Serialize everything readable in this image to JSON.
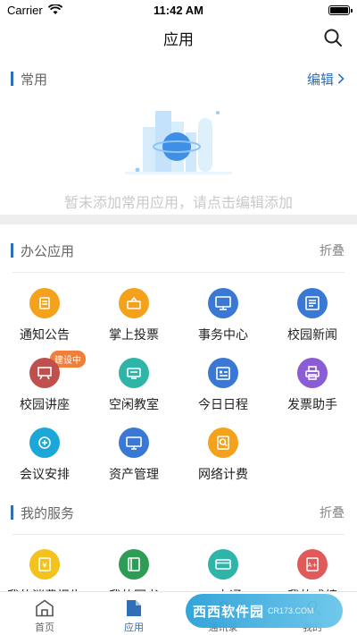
{
  "status": {
    "carrier": "Carrier",
    "time": "11:42 AM"
  },
  "nav": {
    "title": "应用"
  },
  "common": {
    "title": "常用",
    "edit": "编辑",
    "empty": "暂未添加常用应用，请点击编辑添加"
  },
  "office": {
    "title": "办公应用",
    "fold": "折叠",
    "items": [
      {
        "label": "通知公告",
        "icon": "notice-icon",
        "color": "#f4a21c"
      },
      {
        "label": "掌上投票",
        "icon": "vote-icon",
        "color": "#f4a21c"
      },
      {
        "label": "事务中心",
        "icon": "monitor-icon",
        "color": "#3a78d6"
      },
      {
        "label": "校园新闻",
        "icon": "news-icon",
        "color": "#3a78d6"
      },
      {
        "label": "校园讲座",
        "icon": "lecture-icon",
        "color": "#c0504d",
        "badge": "建设中"
      },
      {
        "label": "空闲教室",
        "icon": "classroom-icon",
        "color": "#2eb5a8"
      },
      {
        "label": "今日日程",
        "icon": "schedule-icon",
        "color": "#3a78d6"
      },
      {
        "label": "发票助手",
        "icon": "printer-icon",
        "color": "#8a5cd6"
      },
      {
        "label": "会议安排",
        "icon": "meeting-icon",
        "color": "#1ba8d8"
      },
      {
        "label": "资产管理",
        "icon": "asset-icon",
        "color": "#3a78d6"
      },
      {
        "label": "网络计费",
        "icon": "billing-icon",
        "color": "#f4a21c"
      }
    ]
  },
  "services": {
    "title": "我的服务",
    "fold": "折叠",
    "items": [
      {
        "label": "我的消费报告",
        "icon": "report-icon",
        "color": "#f4c21c"
      },
      {
        "label": "我的图书",
        "icon": "book-icon",
        "color": "#2e9b56"
      },
      {
        "label": "一卡通",
        "icon": "card-icon",
        "color": "#2eb5a8"
      },
      {
        "label": "我的成绩",
        "icon": "grade-icon",
        "color": "#e05a5a"
      }
    ]
  },
  "tabs": [
    {
      "label": "首页",
      "icon": "home-icon"
    },
    {
      "label": "应用",
      "icon": "apps-icon",
      "active": true
    },
    {
      "label": "通讯录",
      "icon": "contacts-icon"
    },
    {
      "label": "我的",
      "icon": "profile-icon"
    }
  ],
  "watermark": {
    "text": "西西软件园",
    "sub": "CR173.COM"
  }
}
